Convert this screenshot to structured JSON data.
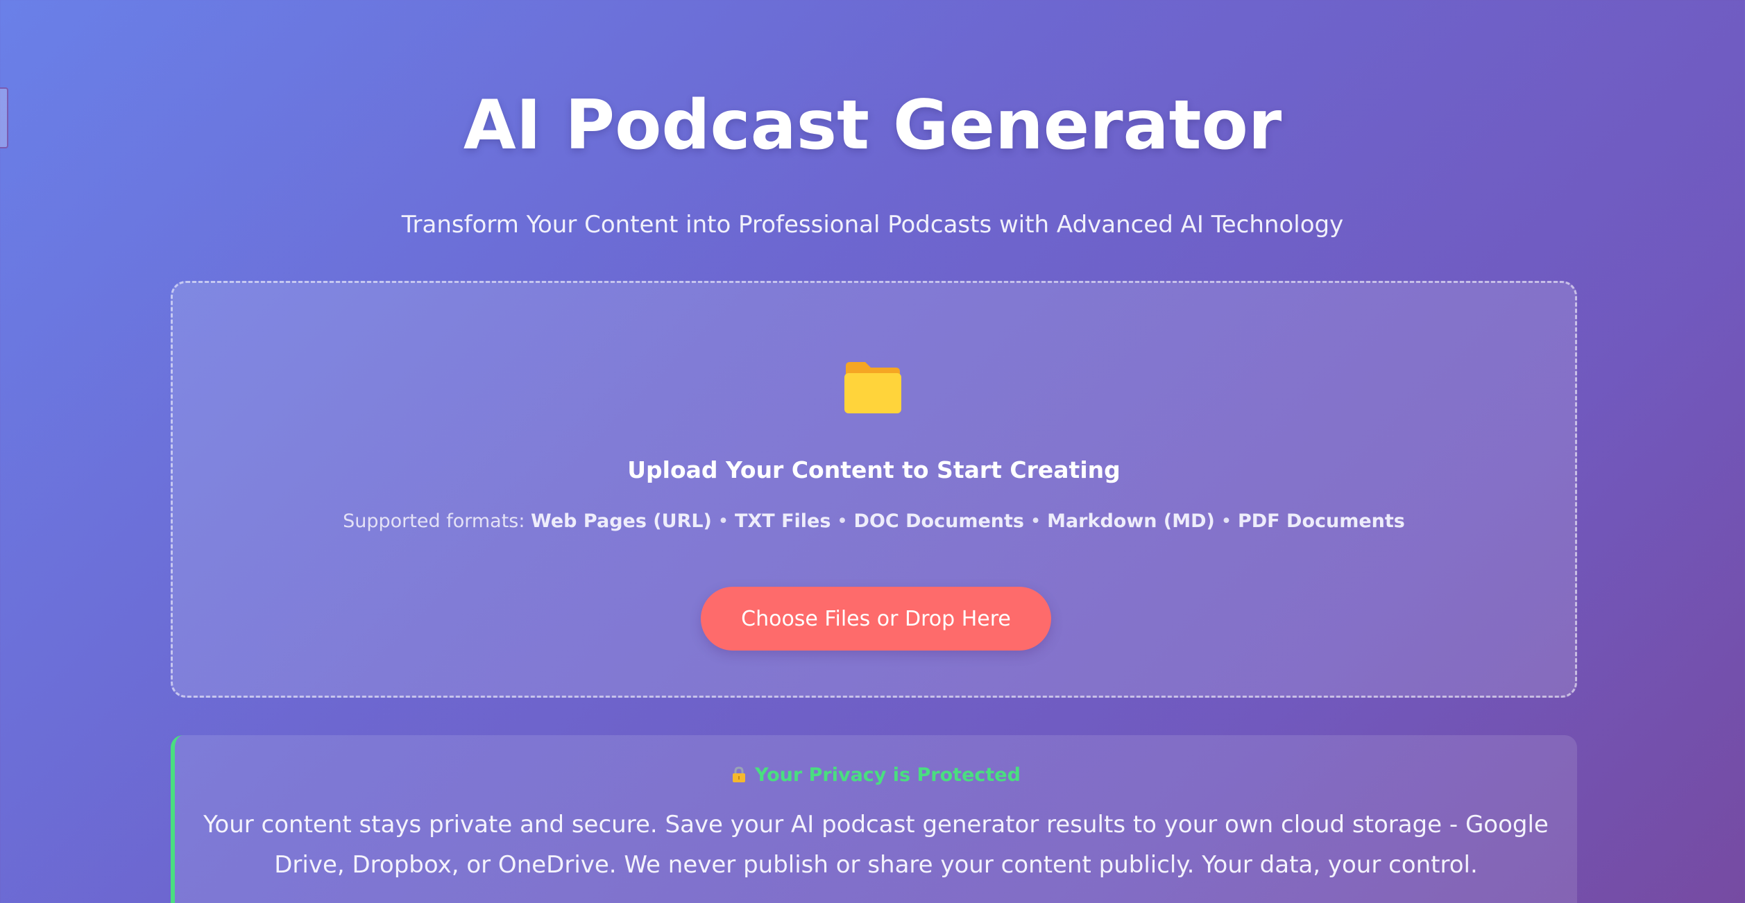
{
  "header": {
    "title": "AI Podcast Generator",
    "subtitle": "Transform Your Content into Professional Podcasts with Advanced AI Technology"
  },
  "upload": {
    "icon": "folder-icon",
    "heading": "Upload Your Content to Start Creating",
    "formats_prefix": "Supported formats:",
    "formats": [
      "Web Pages (URL)",
      "TXT Files",
      "DOC Documents",
      "Markdown (MD)",
      "PDF Documents"
    ],
    "separator": "•",
    "button_label": "Choose Files or Drop Here"
  },
  "privacy": {
    "icon": "lock-icon",
    "heading": "Your Privacy is Protected",
    "text": "Your content stays private and secure. Save your AI podcast generator results to your own cloud storage - Google Drive, Dropbox, or OneDrive. We never publish or share your content publicly. Your data, your control."
  },
  "colors": {
    "background_start": "#667eea",
    "background_end": "#764ba2",
    "button": "#fe6b6b",
    "privacy_accent": "#4ade80",
    "folder_back": "#f5a623",
    "folder_front": "#ffd43b"
  }
}
